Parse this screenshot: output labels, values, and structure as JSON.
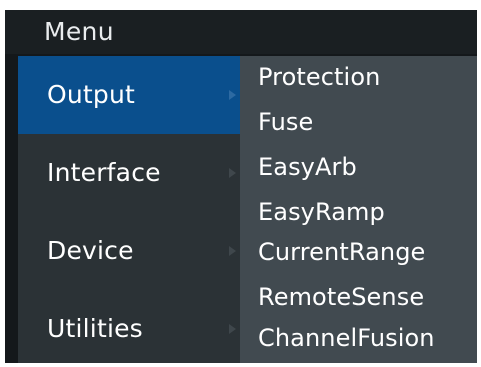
{
  "menu": {
    "title": "Menu",
    "main_items": [
      {
        "label": "Output",
        "selected": true
      },
      {
        "label": "Interface",
        "selected": false
      },
      {
        "label": "Device",
        "selected": false
      },
      {
        "label": "Utilities",
        "selected": false
      }
    ],
    "sub_items": [
      "Protection",
      "Fuse",
      "EasyArb",
      "EasyRamp",
      "CurrentRange",
      "RemoteSense",
      "ChannelFusion"
    ]
  },
  "colors": {
    "selected": "#0a4f8d",
    "left_panel": "#2b3236",
    "right_panel": "#414a50",
    "title_bar": "#1a1f22"
  }
}
